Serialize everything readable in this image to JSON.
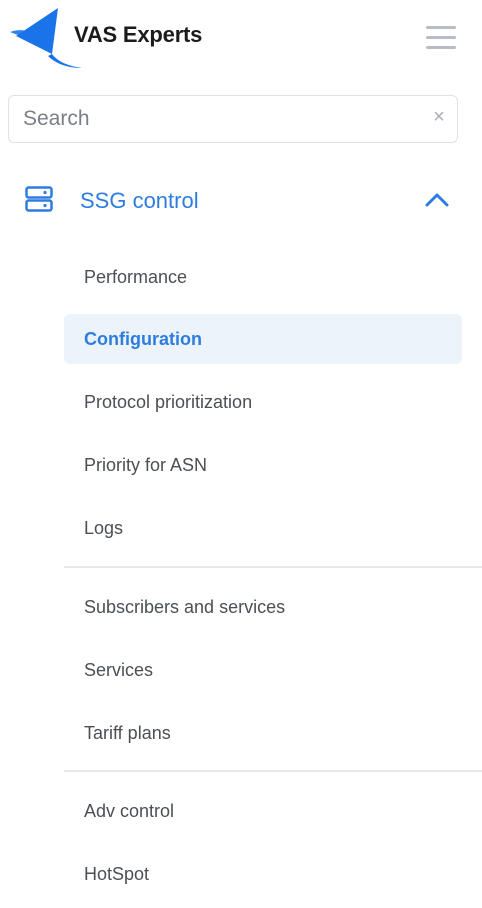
{
  "brand": {
    "name": "VAS Experts",
    "accent_color": "#2d7de0",
    "logo_color": "#1a73e8"
  },
  "header": {
    "menu_icon": "hamburger-icon"
  },
  "search": {
    "placeholder": "Search",
    "value": "",
    "clear_icon": "close-icon"
  },
  "section": {
    "title": "SSG control",
    "icon": "server-icon",
    "expanded": true,
    "toggle_icon": "chevron-up-icon"
  },
  "nav": {
    "group1": [
      {
        "label": "Performance",
        "active": false
      },
      {
        "label": "Configuration",
        "active": true
      },
      {
        "label": "Protocol prioritization",
        "active": false
      },
      {
        "label": "Priority for ASN",
        "active": false
      },
      {
        "label": "Logs",
        "active": false
      }
    ],
    "group2": [
      {
        "label": "Subscribers and services",
        "active": false
      },
      {
        "label": "Services",
        "active": false
      },
      {
        "label": "Tariff plans",
        "active": false
      }
    ],
    "group3": [
      {
        "label": "Adv control",
        "active": false
      },
      {
        "label": "HotSpot",
        "active": false
      }
    ]
  }
}
